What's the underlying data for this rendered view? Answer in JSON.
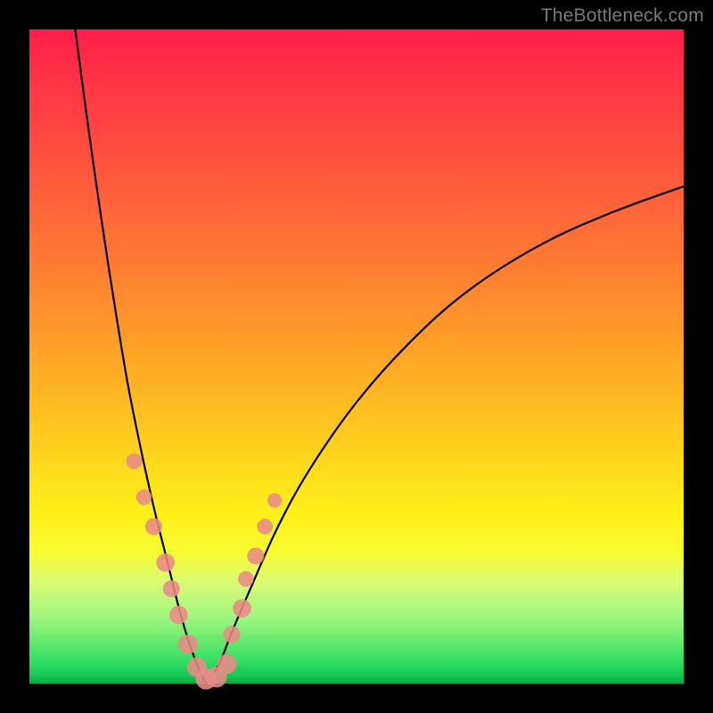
{
  "watermark": "TheBottleneck.com",
  "colors": {
    "page_bg": "#000000",
    "gradient_top": "#ff1e4a",
    "gradient_mid_orange": "#ff7c33",
    "gradient_mid_yellow": "#fff01a",
    "gradient_bottom_green": "#0aa845",
    "dot_fill": "#e98a87",
    "curve_stroke": "#000000",
    "watermark_color": "#7a7a7a"
  },
  "chart_data": {
    "type": "line",
    "title": "",
    "xlabel": "",
    "ylabel": "",
    "xlim": [
      0,
      100
    ],
    "ylim": [
      0,
      100
    ],
    "grid": false,
    "legend": false,
    "notes": "Bottleneck-style V curve. y≈0 near x≈27 (trough). Left arm rises steeply to y≈100 at x≈7. Right arm rises gently to y≈76 at x=100. Pink dots cluster on both arms near the lower region (y≈5–35).",
    "series": [
      {
        "name": "left_arm",
        "x": [
          7,
          9,
          11,
          13,
          15,
          17,
          19,
          21,
          23,
          24.5,
          26,
          27
        ],
        "y": [
          100,
          85,
          71,
          58,
          46,
          36,
          27,
          19,
          11,
          6,
          2,
          0
        ]
      },
      {
        "name": "right_arm",
        "x": [
          27,
          29,
          31,
          34,
          38,
          43,
          50,
          58,
          67,
          78,
          89,
          100
        ],
        "y": [
          0,
          3,
          8,
          15,
          24,
          33,
          43,
          52,
          60,
          67,
          72,
          76
        ]
      }
    ],
    "dots": [
      {
        "x": 16.0,
        "y": 34.0,
        "r": 1.2
      },
      {
        "x": 17.5,
        "y": 28.5,
        "r": 1.2
      },
      {
        "x": 19.0,
        "y": 24.0,
        "r": 1.3
      },
      {
        "x": 20.8,
        "y": 18.5,
        "r": 1.4
      },
      {
        "x": 21.7,
        "y": 14.5,
        "r": 1.3
      },
      {
        "x": 22.8,
        "y": 10.5,
        "r": 1.4
      },
      {
        "x": 24.2,
        "y": 6.0,
        "r": 1.5
      },
      {
        "x": 25.6,
        "y": 2.5,
        "r": 1.5
      },
      {
        "x": 27.0,
        "y": 0.7,
        "r": 1.6
      },
      {
        "x": 28.6,
        "y": 1.0,
        "r": 1.6
      },
      {
        "x": 30.2,
        "y": 3.0,
        "r": 1.5
      },
      {
        "x": 30.9,
        "y": 7.5,
        "r": 1.3
      },
      {
        "x": 32.5,
        "y": 11.5,
        "r": 1.4
      },
      {
        "x": 33.1,
        "y": 16.0,
        "r": 1.2
      },
      {
        "x": 34.6,
        "y": 19.5,
        "r": 1.3
      },
      {
        "x": 36.0,
        "y": 24.0,
        "r": 1.2
      },
      {
        "x": 37.5,
        "y": 28.0,
        "r": 1.1
      }
    ]
  }
}
